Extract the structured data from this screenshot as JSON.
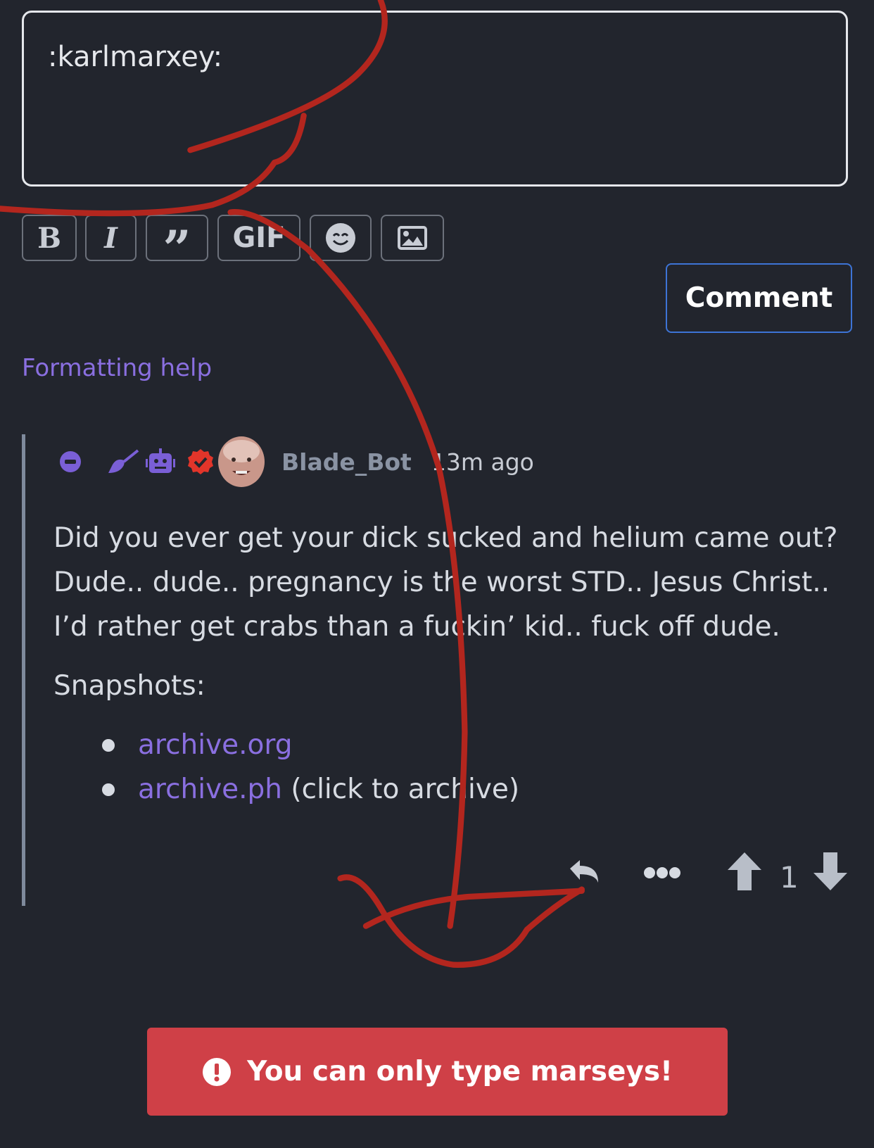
{
  "editor": {
    "value": ":karlmarxey:"
  },
  "toolbar": {
    "bold": "B",
    "italic": "I",
    "quote": "”",
    "gif": "GIF",
    "icons": [
      "bold-icon",
      "italic-icon",
      "quote-icon",
      "gif-icon",
      "emoji-icon",
      "image-icon"
    ]
  },
  "comment_button": "Comment",
  "formatting_help": "Formatting help",
  "comment": {
    "username": "Blade_Bot",
    "time": "13m ago",
    "badges": [
      "minus-circle-icon",
      "broom-icon",
      "robot-icon",
      "verified-badge-icon"
    ],
    "lines": [
      "Did you ever get your dick sucked and helium came out?",
      "Dude.. dude.. pregnancy is the worst STD.. Jesus Christ..",
      "I’d rather get crabs than a fuckin’ kid.. fuck off dude."
    ],
    "snapshots_label": "Snapshots:",
    "snapshots": [
      {
        "link": "archive.org",
        "note": ""
      },
      {
        "link": "archive.ph",
        "note": " (click to archive)"
      }
    ],
    "score": "1"
  },
  "toast": {
    "message": "You can only type marseys!",
    "color": "#cf4047"
  },
  "colors": {
    "background": "#22252d",
    "accent": "#8a6fe0",
    "button_border": "#3d74d6",
    "scribble": "#b3261e"
  }
}
